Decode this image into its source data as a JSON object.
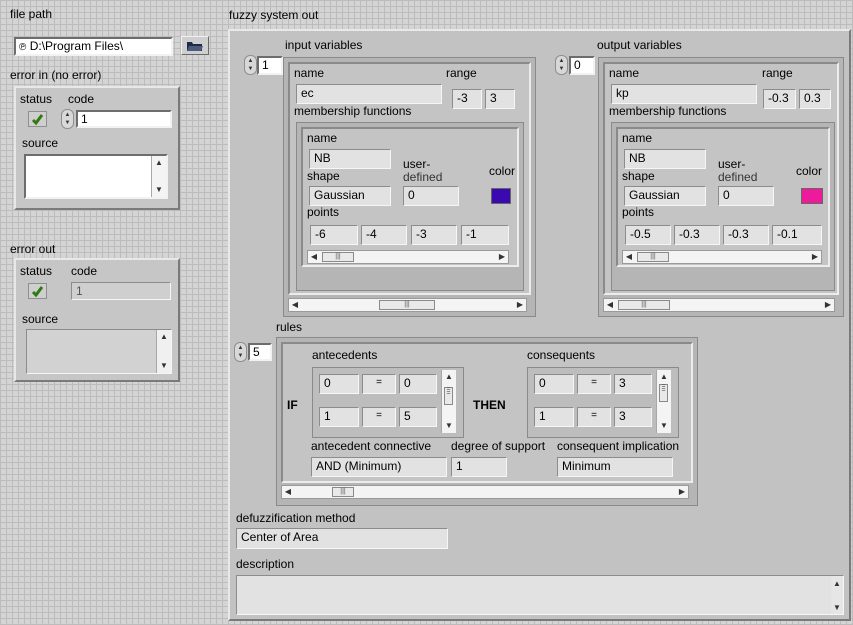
{
  "file_path": {
    "label": "file path",
    "value": "D:\\Program Files\\",
    "prefix_icon": "path-type-glyph",
    "browse_icon": "folder-open-icon"
  },
  "error_in": {
    "label": "error in (no error)",
    "status_label": "status",
    "code_label": "code",
    "code_value": "1",
    "source_label": "source",
    "status_icon": "check-icon"
  },
  "error_out": {
    "label": "error out",
    "status_label": "status",
    "code_label": "code",
    "code_value": "1",
    "source_label": "source",
    "status_icon": "check-icon"
  },
  "fuzzy": {
    "label": "fuzzy system out",
    "input_vars": {
      "label": "input variables",
      "index": "1",
      "name_label": "name",
      "name": "ec",
      "range_label": "range",
      "range_min": "-3",
      "range_max": "3",
      "mf_label": "membership functions",
      "mf_name_label": "name",
      "mf_name": "NB",
      "shape_label": "shape",
      "shape": "Gaussian",
      "user_label_1": "user-",
      "user_label_2": "defined",
      "user_value": "0",
      "color_label": "color",
      "color": "#3a09b0",
      "points_label": "points",
      "points": [
        "-6",
        "-4",
        "-3",
        "-1"
      ]
    },
    "output_vars": {
      "label": "output variables",
      "index": "0",
      "name_label": "name",
      "name": "kp",
      "range_label": "range",
      "range_min": "-0.3",
      "range_max": "0.3",
      "mf_label": "membership functions",
      "mf_name_label": "name",
      "mf_name": "NB",
      "shape_label": "shape",
      "shape": "Gaussian",
      "user_label_1": "user-",
      "user_label_2": "defined",
      "user_value": "0",
      "color_label": "color",
      "color": "#ee1a9c",
      "points_label": "points",
      "points": [
        "-0.5",
        "-0.3",
        "-0.3",
        "-0.1"
      ]
    },
    "rules": {
      "label": "rules",
      "index": "5",
      "antecedents_label": "antecedents",
      "consequents_label": "consequents",
      "if_label": "IF",
      "then_label": "THEN",
      "antecedents": [
        {
          "a": "0",
          "op": "=",
          "b": "0"
        },
        {
          "a": "1",
          "op": "=",
          "b": "5"
        }
      ],
      "consequents": [
        {
          "a": "0",
          "op": "=",
          "b": "3"
        },
        {
          "a": "1",
          "op": "=",
          "b": "3"
        }
      ],
      "connective_label": "antecedent connective",
      "connective": "AND (Minimum)",
      "support_label": "degree of support",
      "support": "1",
      "implication_label": "consequent implication",
      "implication": "Minimum"
    },
    "defuzz_label": "defuzzification method",
    "defuzz": "Center of Area",
    "description_label": "description",
    "description": ""
  }
}
